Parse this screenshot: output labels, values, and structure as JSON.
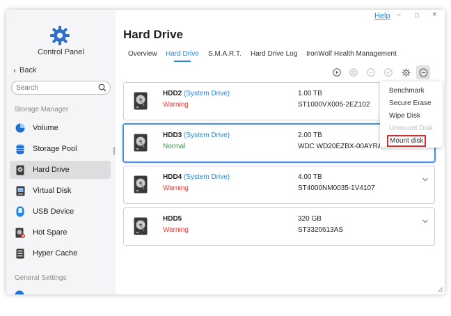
{
  "window": {
    "help_label": "Help",
    "minimize_glyph": "–",
    "maximize_glyph": "□",
    "close_glyph": "×"
  },
  "sidebar": {
    "title": "Control Panel",
    "back_label": "Back",
    "search_placeholder": "Search",
    "section_storage": "Storage Manager",
    "section_general": "General Settings",
    "items": [
      {
        "label": "Volume",
        "icon": "volume-icon"
      },
      {
        "label": "Storage Pool",
        "icon": "storage-pool-icon"
      },
      {
        "label": "Hard Drive",
        "icon": "hard-drive-icon",
        "active": true
      },
      {
        "label": "Virtual Disk",
        "icon": "virtual-disk-icon"
      },
      {
        "label": "USB Device",
        "icon": "usb-device-icon"
      },
      {
        "label": "Hot Spare",
        "icon": "hot-spare-icon"
      },
      {
        "label": "Hyper Cache",
        "icon": "hyper-cache-icon"
      }
    ]
  },
  "main": {
    "title": "Hard Drive",
    "tabs": [
      {
        "label": "Overview"
      },
      {
        "label": "Hard Drive",
        "active": true
      },
      {
        "label": "S.M.A.R.T."
      },
      {
        "label": "Hard Drive Log"
      },
      {
        "label": "IronWolf Health Management"
      }
    ],
    "disks": [
      {
        "name": "HDD2",
        "system": "(System Drive)",
        "status": "Warning",
        "size": "1.00 TB",
        "model": "ST1000VX005-2EZ102"
      },
      {
        "name": "HDD3",
        "system": "(System Drive)",
        "status": "Normal",
        "size": "2.00 TB",
        "model": "WDC WD20EZBX-00AYRA"
      },
      {
        "name": "HDD4",
        "system": "(System Drive)",
        "status": "Warning",
        "size": "4.00 TB",
        "model": "ST4000NM0035-1V4107"
      },
      {
        "name": "HDD5",
        "system": "",
        "status": "Warning",
        "size": "320 GB",
        "model": "ST3320613AS"
      }
    ]
  },
  "menu": {
    "items": [
      {
        "label": "Benchmark"
      },
      {
        "label": "Secure Erase"
      },
      {
        "label": "Wipe Disk"
      },
      {
        "label": "Unmount Disk",
        "disabled": true
      },
      {
        "label": "Mount disk",
        "highlighted": true
      }
    ]
  },
  "colors": {
    "accent": "#1e88e5",
    "warning": "#e53935",
    "normal": "#2e9a3e",
    "highlight_box": "#d32f2f"
  }
}
